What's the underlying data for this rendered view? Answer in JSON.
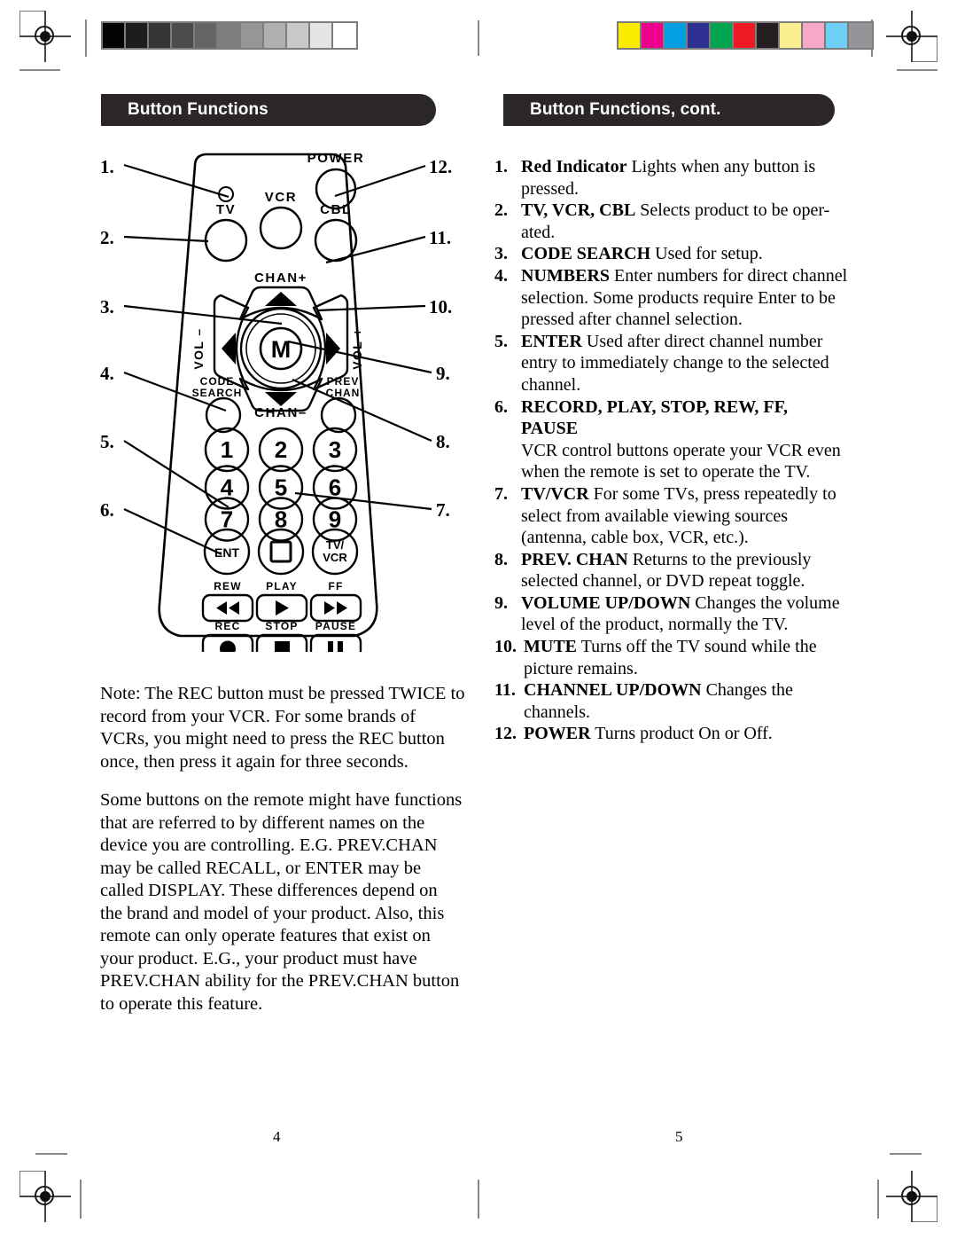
{
  "page": {
    "left_page_number": "4",
    "right_page_number": "5"
  },
  "left_column": {
    "header": "Button Functions",
    "callout_numbers": [
      "1.",
      "2.",
      "3.",
      "4.",
      "5.",
      "6."
    ],
    "note_paragraph": "Note: The REC button must be pressed TWICE to record from your VCR. For some brands of VCRs, you might need to press the REC button once, then press it again for three seconds.",
    "info_paragraph": "Some buttons on the remote might have functions that are referred to by different names on the device you are controlling. E.G. PREV.CHAN may be called RECALL, or ENTER may be called DISPLAY. These differences depend on the brand and model of your product. Also, this remote can only operate features that exist on your product. E.G., your product must have PREV.CHAN ability for the PREV.CHAN button to operate this feature."
  },
  "right_column": {
    "header": "Button Functions, cont.",
    "callout_numbers": [
      "12.",
      "11.",
      "10.",
      "9.",
      "8.",
      "7."
    ],
    "items": [
      {
        "num": "1.",
        "term": "Red Indicator",
        "desc": "Lights when any button is pressed."
      },
      {
        "num": "2.",
        "term": "TV, VCR, CBL",
        "desc": "Selects product to be oper-ated."
      },
      {
        "num": "3.",
        "term": "CODE SEARCH",
        "desc": "Used for setup."
      },
      {
        "num": "4.",
        "term": "NUMBERS",
        "desc": "Enter numbers for direct channel selection. Some products require Enter to be pressed after channel selection."
      },
      {
        "num": "5.",
        "term": "ENTER",
        "desc": "Used after direct channel number entry to immediately change to the selected channel."
      },
      {
        "num": "6.",
        "term": "RECORD, PLAY, STOP, REW, FF, PAUSE",
        "desc": "VCR control buttons operate your VCR even when the remote is set to operate the TV.",
        "desc_on_new_line": true
      },
      {
        "num": "7.",
        "term": "TV/VCR",
        "desc": "For some TVs, press repeatedly to select from available viewing sources (antenna, cable box, VCR, etc.)."
      },
      {
        "num": "8.",
        "term": "PREV. CHAN",
        "desc": "Returns to the previously selected channel, or DVD repeat toggle."
      },
      {
        "num": "9.",
        "term": "VOLUME UP/DOWN",
        "desc": "Changes the volume level of the product, normally the TV."
      },
      {
        "num": "10.",
        "term": "MUTE",
        "desc": "Turns off the TV sound while the picture remains."
      },
      {
        "num": "11.",
        "term": "CHANNEL UP/DOWN",
        "desc": "Changes the channels."
      },
      {
        "num": "12.",
        "term": "POWER",
        "desc": "Turns product On or Off."
      }
    ]
  },
  "remote_diagram": {
    "labels": {
      "power": "POWER",
      "tv": "TV",
      "vcr": "VCR",
      "cbl": "CBL",
      "chan_up": "CHAN+",
      "chan_down": "CHAN–",
      "vol_down": "VOL –",
      "vol_up": "VOL +",
      "mute": "M",
      "code_search_line1": "CODE",
      "code_search_line2": "SEARCH",
      "prev_chan_line1": "PREV",
      "prev_chan_line2": "CHAN",
      "ent": "ENT",
      "tvvcr_line1": "TV/",
      "tvvcr_line2": "VCR",
      "rew": "REW",
      "play": "PLAY",
      "ff": "FF",
      "rec": "REC",
      "stop": "STOP",
      "pause": "PAUSE"
    },
    "number_keys": [
      "1",
      "2",
      "3",
      "4",
      "5",
      "6",
      "7",
      "8",
      "9"
    ]
  },
  "print_marks": {
    "gray_wedge": [
      "#030303",
      "#1d1d1d",
      "#343434",
      "#4c4c4c",
      "#646464",
      "#7d7d7d",
      "#969696",
      "#afafaf",
      "#c8c8c8",
      "#e4e4e4",
      "#ffffff"
    ],
    "color_bars": [
      "#fced00",
      "#ec008c",
      "#00a0e3",
      "#2e3192",
      "#00a551",
      "#ed1c24",
      "#231f20",
      "#faee90",
      "#f7a8c8",
      "#6dcff6",
      "#939598"
    ]
  },
  "colors": {
    "header_bg": "#2b2726",
    "header_text": "#ffffff",
    "ink": "#000000"
  }
}
